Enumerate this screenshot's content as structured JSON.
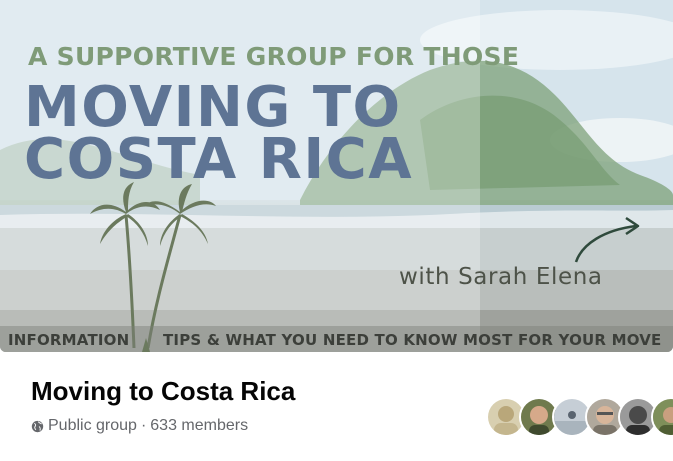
{
  "cover": {
    "tagline": "A SUPPORTIVE GROUP FOR THOSE",
    "headline_line1": "MOVING TO",
    "headline_line2": "COSTA RICA",
    "host": "with Sarah Elena",
    "bottom_left": "INFORMATION",
    "bottom_right": "TIPS &  WHAT YOU NEED TO KNOW MOST FOR YOUR MOVE"
  },
  "group": {
    "name": "Moving to Costa Rica",
    "privacy": "Public group",
    "separator": "·",
    "members": "633 members"
  },
  "icons": {
    "privacy_icon": "globe-icon",
    "palm_icon": "palm-tree-icon",
    "arrow_icon": "curved-arrow-icon"
  },
  "colors": {
    "tagline": "#7f9b78",
    "headline": "#5e7494",
    "title": "#050505",
    "meta": "#65676b"
  },
  "member_avatars": [
    {
      "id": "member-1",
      "color": "#c9bfa3"
    },
    {
      "id": "member-2",
      "color": "#6f7a4d"
    },
    {
      "id": "member-3",
      "color": "#b8c0c8"
    },
    {
      "id": "member-4",
      "color": "#a9a39a"
    },
    {
      "id": "member-5",
      "color": "#5b5b5b"
    },
    {
      "id": "member-6",
      "color": "#7e8f5a"
    }
  ]
}
